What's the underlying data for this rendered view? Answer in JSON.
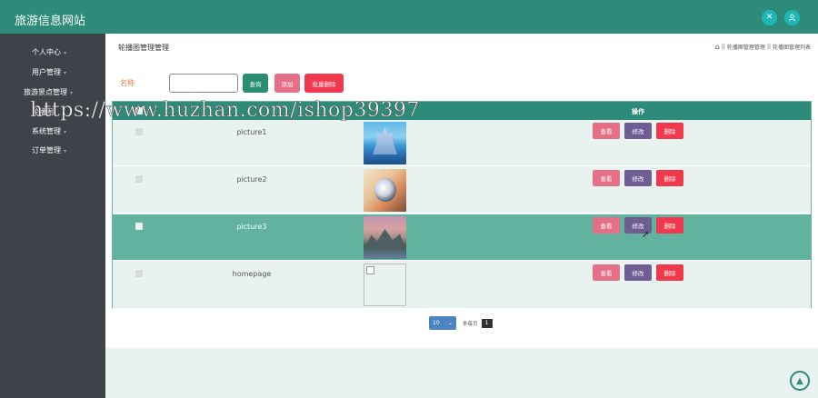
{
  "app": {
    "title": "旅游信息网站"
  },
  "header": {
    "icons": [
      {
        "name": "tools-icon",
        "glyph": "✕"
      },
      {
        "name": "user-icon",
        "glyph": "👤"
      }
    ]
  },
  "sidebar": {
    "items": [
      {
        "label": "个人中心",
        "chevron": "▾"
      },
      {
        "label": "用户管理",
        "chevron": "▾"
      },
      {
        "label": "旅游景点管理",
        "chevron": "▾"
      },
      {
        "label": "轮播图",
        "chevron": ""
      },
      {
        "label": "系统管理",
        "chevron": "▾"
      },
      {
        "label": "订单管理",
        "chevron": "▾"
      }
    ]
  },
  "main": {
    "page_title": "轮播图管理管理",
    "breadcrumb": [
      "轮播图管理管理",
      "轮播图管理列表"
    ],
    "breadcrumb_sep": "||",
    "search": {
      "label": "名称",
      "value": "",
      "placeholder": ""
    },
    "buttons": {
      "search": "查询",
      "add": "添加",
      "batch_delete": "批量删除"
    },
    "table": {
      "header": {
        "ops": "操作"
      },
      "rows": [
        {
          "name": "picture1",
          "image": "castle"
        },
        {
          "name": "picture2",
          "image": "deco"
        },
        {
          "name": "picture3",
          "image": "mountain"
        },
        {
          "name": "homepage",
          "image": "broken"
        }
      ],
      "op_labels": {
        "view": "查看",
        "edit": "修改",
        "delete": "删除"
      }
    },
    "pager": {
      "page_size": "10",
      "label": "条每页",
      "current_page": "1"
    }
  },
  "watermark": "https://www.huzhan.com/ishop39397",
  "colors": {
    "topbar": "#2e8b7a",
    "sidebar": "#3d4348",
    "accent": "#1fb7b5",
    "view_button": "#e56f86",
    "edit_button": "#6d5d92",
    "delete_button": "#f0394d"
  }
}
